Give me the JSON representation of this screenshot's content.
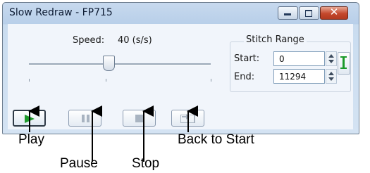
{
  "window": {
    "title": "Slow Redraw - FP715"
  },
  "caption_buttons": {
    "minimize_icon": "minimize-icon",
    "maximize_icon": "maximize-icon",
    "close_glyph": "✕"
  },
  "speed": {
    "label": "Speed:",
    "value": "40 (s/s)",
    "slider_fraction": 0.44
  },
  "stitch_range": {
    "title": "Stitch Range",
    "start_label": "Start:",
    "start_value": "0",
    "end_label": "End:",
    "end_value": "11294"
  },
  "controls": [
    {
      "name": "play",
      "icon": "play-icon"
    },
    {
      "name": "pause",
      "icon": "pause-icon"
    },
    {
      "name": "stop",
      "icon": "stop-icon"
    },
    {
      "name": "back-to-start",
      "icon": "back-to-start-icon"
    }
  ],
  "callouts": {
    "play": "Play",
    "pause": "Pause",
    "stop": "Stop",
    "back_to_start": "Back to Start"
  },
  "colors": {
    "play_green": "#1f9a2b",
    "close_red": "#c4482c",
    "titlebar": "#b8cfe9"
  }
}
